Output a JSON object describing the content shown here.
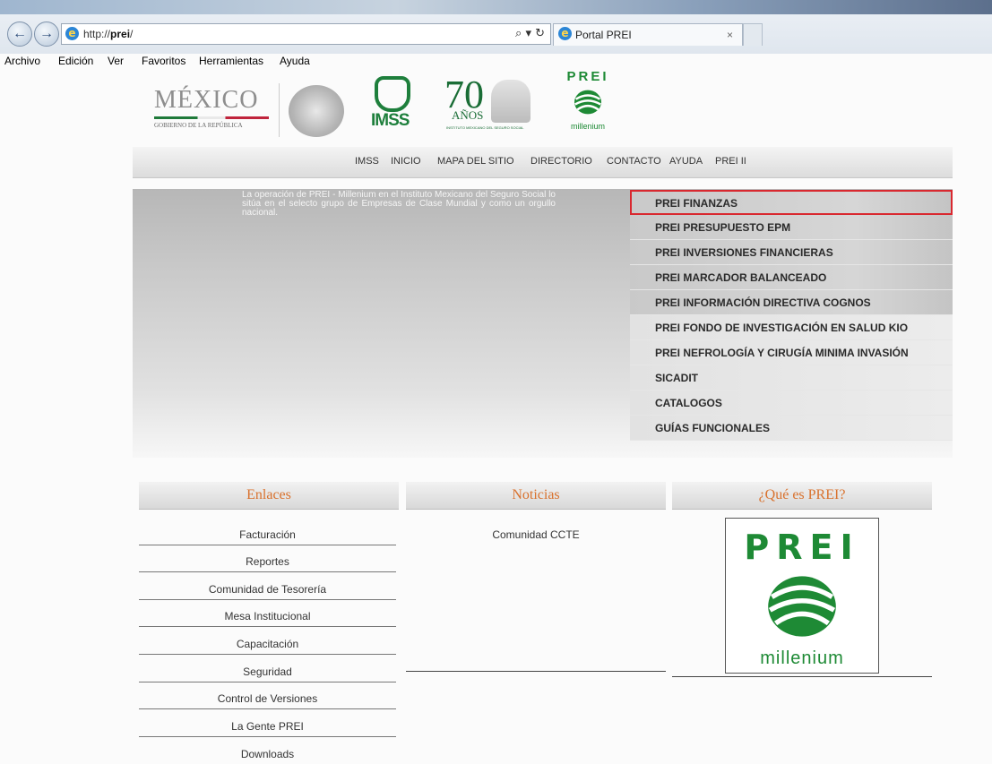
{
  "browser": {
    "url_prefix": "http://",
    "url_host": "prei",
    "url_suffix": "/",
    "tab_title": "Portal PREI",
    "tab_close": "×",
    "search_glyph": "⌕ ▾ ↻",
    "menu": [
      "Archivo",
      "Edición",
      "Ver",
      "Favoritos",
      "Herramientas",
      "Ayuda"
    ]
  },
  "header": {
    "mexico": "MÉXICO",
    "gobierno": "GOBIERNO DE LA REPÚBLICA",
    "imss": "IMSS",
    "seventy": "70",
    "anos": "AÑOS",
    "instituto": "INSTITUTO MEXICANO DEL SEGURO SOCIAL",
    "prei": "PREI",
    "millenium": "millenium"
  },
  "topnav": [
    "IMSS",
    "INICIO",
    "MAPA DEL SITIO",
    "DIRECTORIO",
    "CONTACTO",
    "AYUDA",
    "PREI II"
  ],
  "hero": {
    "text": "La operación de PREI - Millenium en el Instituto Mexicano del Seguro Social lo sitúa en el selecto grupo de Empresas de Clase Mundial y como un orgullo nacional."
  },
  "sidemenu": [
    "PREI FINANZAS",
    "PREI PRESUPUESTO EPM",
    "PREI INVERSIONES FINANCIERAS",
    "PREI MARCADOR BALANCEADO",
    "PREI INFORMACIÓN DIRECTIVA COGNOS",
    "PREI FONDO DE INVESTIGACIÓN EN SALUD KIO",
    "PREI NEFROLOGÍA Y CIRUGÍA MINIMA INVASIÓN",
    "SICADIT",
    "CATALOGOS",
    "GUÍAS FUNCIONALES"
  ],
  "columns": {
    "enlaces": "Enlaces",
    "noticias": "Noticias",
    "que_es": "¿Qué es PREI?"
  },
  "enlaces": [
    "Facturación",
    "Reportes",
    "Comunidad de Tesorería",
    "Mesa Institucional",
    "Capacitación",
    "Seguridad",
    "Control de Versiones",
    "La Gente PREI",
    "Downloads"
  ],
  "noticias": [
    "Comunidad CCTE"
  ],
  "prei_box": {
    "title": "PREI",
    "subtitle": "millenium"
  },
  "colors": {
    "green": "#1e8a35",
    "accent": "#d9722e",
    "highlight": "#d9282f"
  }
}
